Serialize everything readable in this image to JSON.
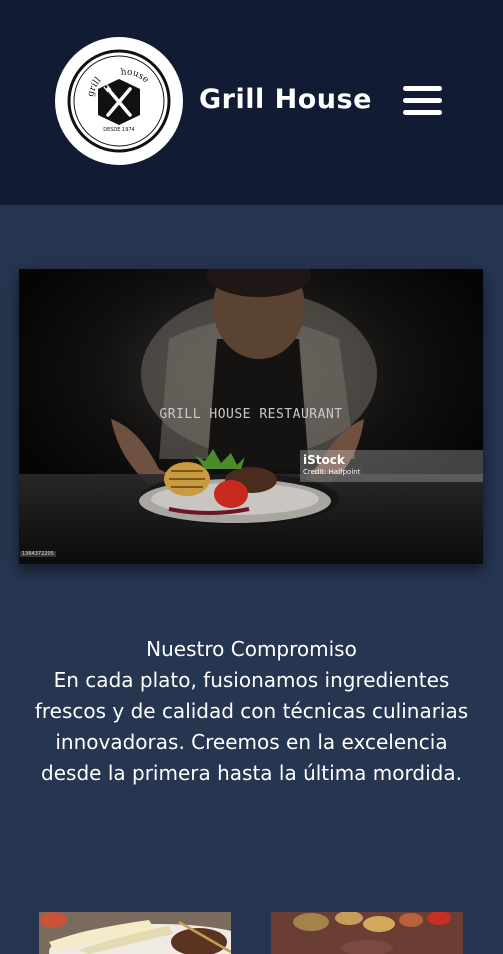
{
  "header": {
    "brand_name": "Grill House",
    "logo": {
      "top_text": "grill",
      "side_text": "house",
      "est_text": "DESDE 1974",
      "icon": "crossed-fork-knife-icon"
    },
    "menu_icon": "hamburger-menu-icon",
    "background_color": "#111b33"
  },
  "hero": {
    "caption": "GRILL HOUSE RESTAURANT",
    "watermark_brand": "iStock",
    "watermark_credit": "Credit: Halfpoint",
    "stock_id": "1364372205"
  },
  "commitment": {
    "title": "Nuestro Compromiso",
    "body": "En cada plato, fusionamos ingredientes frescos y de calidad con técnicas culinarias innovadoras. Creemos en la excelencia desde la primera hasta la última mordida."
  },
  "page": {
    "background_color": "#263550",
    "text_color": "#ffffff"
  }
}
